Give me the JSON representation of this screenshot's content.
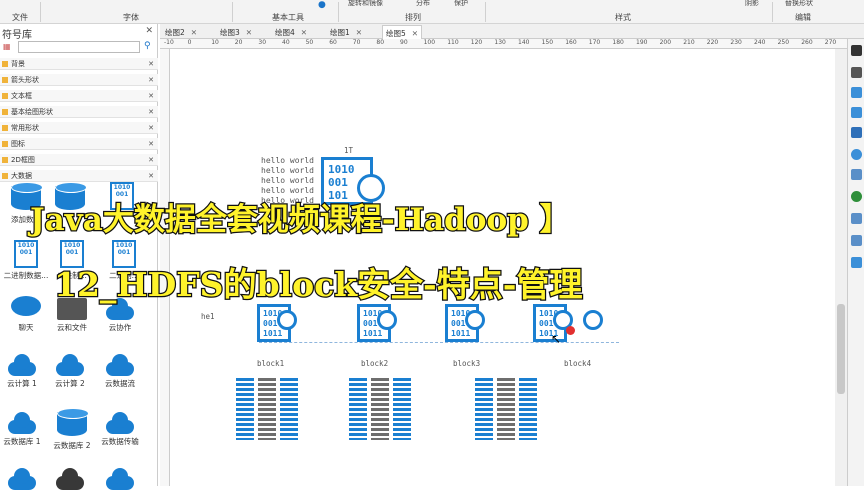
{
  "ribbon": {
    "groups": [
      {
        "label": "文件"
      },
      {
        "label": "字体"
      },
      {
        "label": "基本工具"
      },
      {
        "label": "排列"
      },
      {
        "label": "样式"
      },
      {
        "label": "编辑"
      }
    ],
    "top_items": {
      "rotate": "旋转和镜像",
      "distribute": "分布",
      "protect": "保护",
      "shadow": "阴影",
      "replace": "替换形状"
    }
  },
  "tabs": [
    {
      "label": "绘图2"
    },
    {
      "label": "绘图3"
    },
    {
      "label": "绘图4"
    },
    {
      "label": "绘图1"
    },
    {
      "label": "绘图5"
    }
  ],
  "sidebar": {
    "title": "符号库",
    "close": "✕",
    "libraries": [
      "背景",
      "箭头形状",
      "文本框",
      "基本绘图形状",
      "常用形状",
      "图标",
      "2D框图",
      "大数据"
    ],
    "shapes": [
      {
        "label": "添加数据",
        "icon": "database-add-icon"
      },
      {
        "label": "",
        "icon": "database-icon"
      },
      {
        "label": "",
        "icon": "binary-doc-icon"
      },
      {
        "label": "二进制数据...",
        "icon": "binary-search-icon"
      },
      {
        "label": "二进制...",
        "icon": "binary-search-icon"
      },
      {
        "label": "二进制...",
        "icon": "binary-grid-icon"
      },
      {
        "label": "聊天",
        "icon": "chat-icon"
      },
      {
        "label": "云和文件",
        "icon": "cloud-folder-icon"
      },
      {
        "label": "云协作",
        "icon": "cloud-collab-icon"
      },
      {
        "label": "云计算 1",
        "icon": "cloud-compute-icon"
      },
      {
        "label": "云计算 2",
        "icon": "cloud-compute-icon"
      },
      {
        "label": "云数据流",
        "icon": "cloud-flow-icon"
      },
      {
        "label": "云数据库 1",
        "icon": "cloud-db-icon"
      },
      {
        "label": "云数据库 2",
        "icon": "cloud-db-icon"
      },
      {
        "label": "云数据传输",
        "icon": "cloud-transfer-icon"
      }
    ]
  },
  "ruler": {
    "marks": [
      "-10",
      "0",
      "10",
      "20",
      "30",
      "40",
      "50",
      "60",
      "70",
      "80",
      "90",
      "100",
      "110",
      "120",
      "130",
      "140",
      "150",
      "160",
      "170",
      "180",
      "190",
      "200",
      "210",
      "220",
      "230",
      "240",
      "250",
      "260",
      "270",
      "280"
    ]
  },
  "diagram": {
    "hello_lines": [
      "hello world",
      "hello world",
      "hello world",
      "hello world",
      "hello world"
    ],
    "file_label": "1T",
    "big_binary": [
      "1010",
      "001",
      "101"
    ],
    "small_binary": [
      "1010",
      "001",
      "1011"
    ],
    "he_label": "he1",
    "blocks": [
      "block1",
      "block2",
      "block3",
      "block4"
    ]
  },
  "overlay": {
    "line1_a": "Java大数据全套视频课程-Hadoop",
    "line1_b": "】",
    "line2": "12_HDFS的block安全-特点-管理"
  },
  "colors": {
    "accent": "#1a7fd1",
    "overlay_text": "#fff32b",
    "overlay_stroke": "#111111"
  }
}
